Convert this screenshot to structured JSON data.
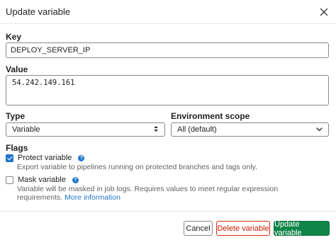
{
  "modal": {
    "title": "Update variable"
  },
  "key": {
    "label": "Key",
    "value": "DEPLOY_SERVER_IP"
  },
  "value": {
    "label": "Value",
    "text": "54.242.149.161"
  },
  "type": {
    "label": "Type",
    "selected": "Variable"
  },
  "scope": {
    "label": "Environment scope",
    "selected": "All (default)"
  },
  "flags": {
    "label": "Flags",
    "protect": {
      "title": "Protect variable",
      "checked": true,
      "description": "Export variable to pipelines running on protected branches and tags only."
    },
    "mask": {
      "title": "Mask variable",
      "checked": false,
      "description": "Variable will be masked in job logs. Requires values to meet regular expression requirements.",
      "link": "More information"
    }
  },
  "buttons": {
    "cancel": "Cancel",
    "delete": "Delete variable",
    "update": "Update variable"
  },
  "colors": {
    "accent": "#1f75cb",
    "primary_button": "#108548",
    "danger": "#dd2b0e"
  },
  "icons": {
    "close": "close-icon",
    "select_arrows": "sort-arrows-icon",
    "dropdown": "chevron-down-icon",
    "help": "question-circle-icon"
  }
}
